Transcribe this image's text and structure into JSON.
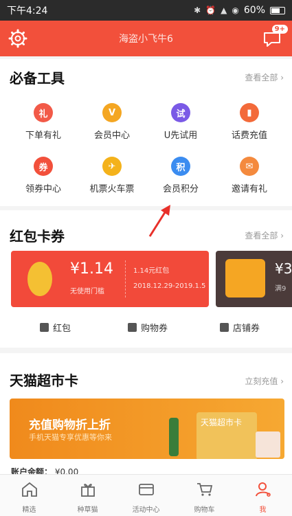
{
  "status_bar": {
    "time": "下午4:24",
    "battery": "60%"
  },
  "header": {
    "title": "海盗小飞牛6",
    "msg_badge": "9+"
  },
  "tools": {
    "title": "必备工具",
    "link": "查看全部",
    "items": [
      {
        "label": "下单有礼",
        "icon": "gift-icon",
        "color": "#f25a48",
        "glyph": "礼"
      },
      {
        "label": "会员中心",
        "icon": "vip-icon",
        "color": "#f4a622",
        "glyph": "V"
      },
      {
        "label": "U先试用",
        "icon": "trial-icon",
        "color": "#7a5ae6",
        "glyph": "试"
      },
      {
        "label": "话费充值",
        "icon": "phone-icon",
        "color": "#f36a3a",
        "glyph": "▮"
      },
      {
        "label": "领券中心",
        "icon": "coupon-icon",
        "color": "#f2503b",
        "glyph": "券"
      },
      {
        "label": "机票火车票",
        "icon": "plane-icon",
        "color": "#f4b21b",
        "glyph": "✈"
      },
      {
        "label": "会员积分",
        "icon": "points-icon",
        "color": "#3b8cf0",
        "glyph": "积"
      },
      {
        "label": "邀请有礼",
        "icon": "invite-icon",
        "color": "#f48a3e",
        "glyph": "✉"
      }
    ]
  },
  "coupons": {
    "title": "红包卡券",
    "link": "查看全部",
    "main": {
      "amount": "¥1.14",
      "condition": "无使用门槛",
      "name": "1.14元红包",
      "validity": "2018.12.29-2019.1.5"
    },
    "side": {
      "amount": "¥3",
      "condition": "满9"
    },
    "tabs": [
      "红包",
      "购物券",
      "店铺券"
    ]
  },
  "supermarket": {
    "title": "天猫超市卡",
    "link": "立刻充值",
    "banner_title": "充值购物折上折",
    "banner_sub": "手机天猫专享优惠等你来",
    "card_label": "天猫超市卡"
  },
  "balance": {
    "label": "账户余额：",
    "value": "¥0.00"
  },
  "tabbar": [
    {
      "label": "精选",
      "icon": "home-icon"
    },
    {
      "label": "种草猫",
      "icon": "gift-box-icon"
    },
    {
      "label": "活动中心",
      "icon": "wallet-icon"
    },
    {
      "label": "购物车",
      "icon": "cart-icon"
    },
    {
      "label": "我",
      "icon": "user-icon",
      "active": true
    }
  ],
  "colors": {
    "accent": "#f2503b",
    "banner": "#f6a832"
  }
}
